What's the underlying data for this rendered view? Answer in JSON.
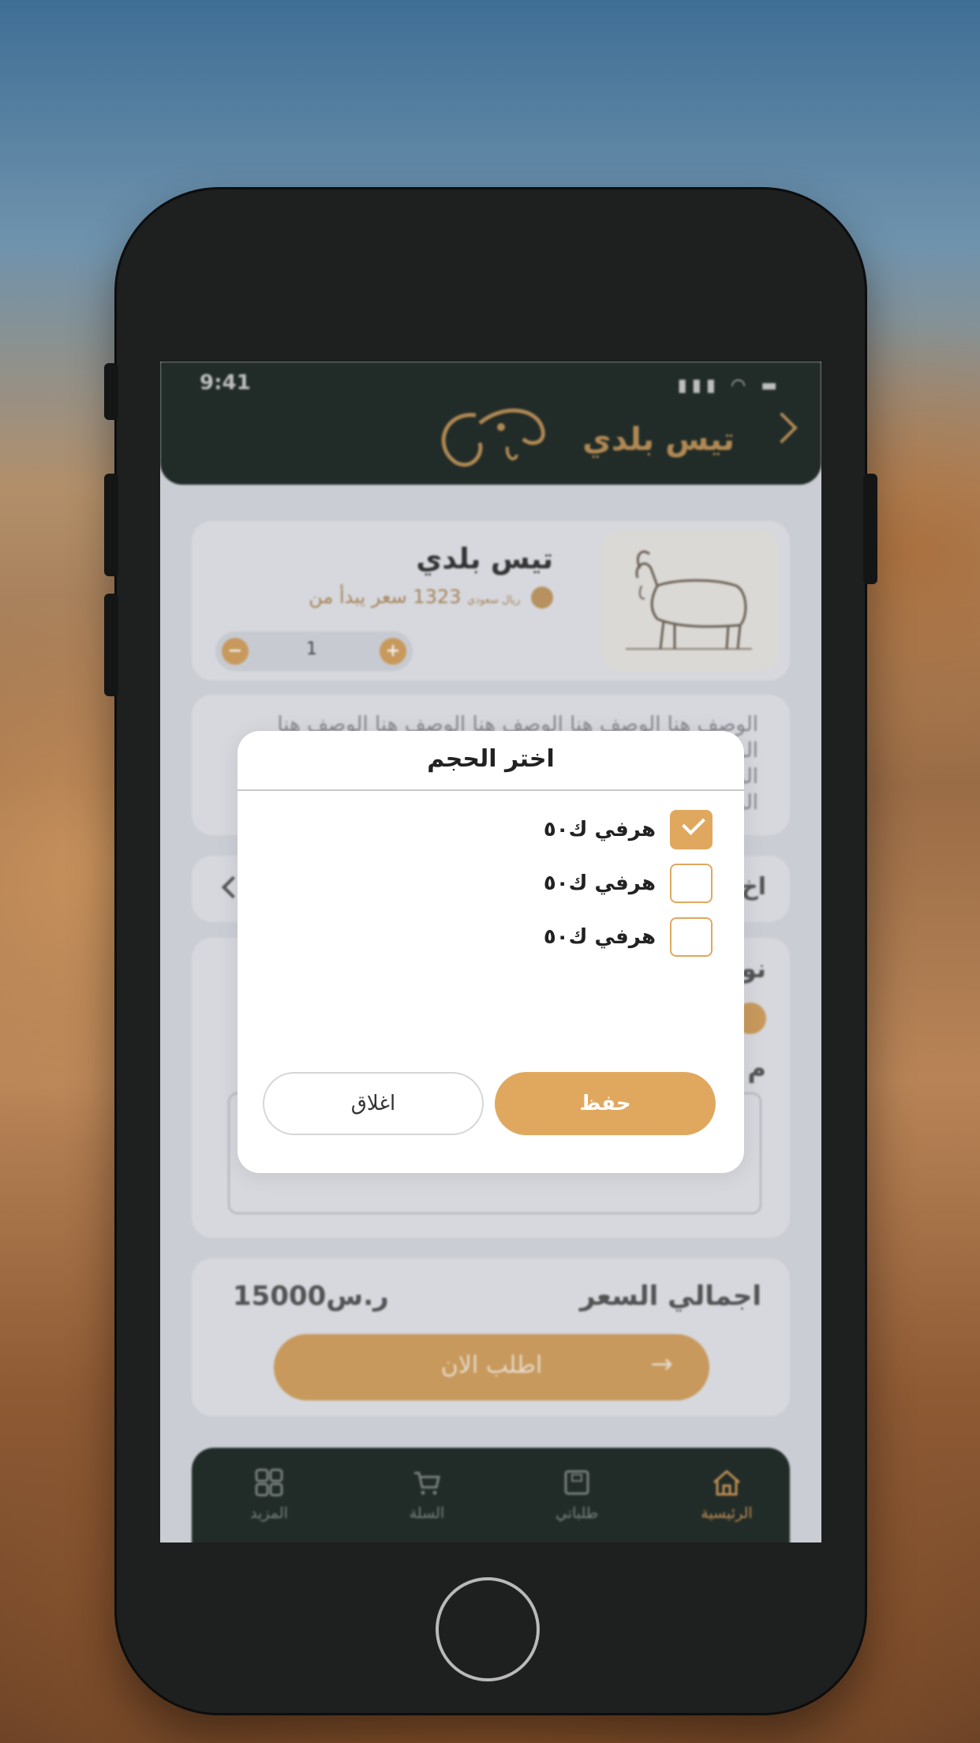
{
  "status_bar": {
    "time": "9:41"
  },
  "header": {
    "title": "تيس بلدي"
  },
  "product": {
    "name": "تيس بلدي",
    "price_prefix": "سعر يبدأ من",
    "price_value": "1323",
    "price_currency": "ريال سعودي",
    "quantity": "1",
    "minus_symbol": "−",
    "plus_symbol": "+"
  },
  "description": {
    "text": "الوصف هنا الوصف هنا الوصف هنا الوصف هنا الوصف هنا الوصف هنا الوصف هنا الوصف هنا الوصف هنا الوصف هنا الوصف هنا الوصف هنا الوصف هنا الوصف هنا الوصف هنا الوصف هنا"
  },
  "background_rows": {
    "row_fragment_1": "اخ",
    "row_fragment_2": "نو",
    "row_fragment_3": "م"
  },
  "totals": {
    "label": "اجمالي السعر",
    "value": "15000ر.س",
    "order_button": "اطلب الان",
    "order_arrow": "→"
  },
  "navbar": {
    "items": [
      {
        "label": "الرئيسية",
        "icon": "home-icon",
        "active": true
      },
      {
        "label": "طلباتي",
        "icon": "orders-icon",
        "active": false
      },
      {
        "label": "السلة",
        "icon": "cart-icon",
        "active": false
      },
      {
        "label": "المزيد",
        "icon": "grid-icon",
        "active": false
      }
    ]
  },
  "modal": {
    "title": "اختر الحجم",
    "options": [
      {
        "label": "هرفي ك٥٠",
        "checked": true
      },
      {
        "label": "هرفي ك٥٠",
        "checked": false
      },
      {
        "label": "هرفي ك٥٠",
        "checked": false
      }
    ],
    "save_label": "حفظ",
    "close_label": "اغلاق"
  },
  "colors": {
    "accent": "#e0a85e",
    "header_bg": "#1f2a25",
    "screen_bg": "#d7dae1"
  }
}
